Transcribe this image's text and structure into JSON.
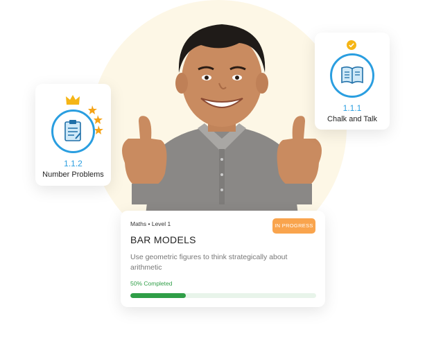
{
  "lessons": [
    {
      "number": "1.1.2",
      "name": "Number Problems",
      "icon": "clipboard-icon",
      "badge": "crown-icon",
      "decor": "stars-icon"
    },
    {
      "number": "1.1.1",
      "name": "Chalk and Talk",
      "icon": "open-book-icon",
      "badge": "check-badge-icon"
    }
  ],
  "course": {
    "breadcrumb": "Maths • Level 1",
    "status": "IN PROGRESS",
    "title": "BAR MODELS",
    "description": "Use geometric figures to think strategically about arithmetic",
    "progress_label": "50% Completed",
    "progress_fraction": 0.3
  },
  "colors": {
    "accent_blue": "#2a9ee0",
    "status_orange": "#f9a44d",
    "progress_green": "#2f9e47",
    "gold": "#f5b516"
  }
}
